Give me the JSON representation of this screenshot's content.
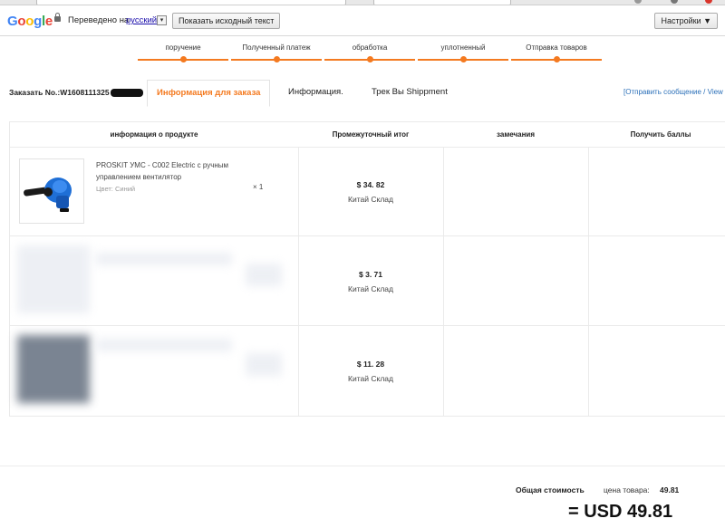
{
  "translate_bar": {
    "logo_letters": [
      {
        "ch": "G",
        "color": "#4285f4"
      },
      {
        "ch": "o",
        "color": "#ea4335"
      },
      {
        "ch": "o",
        "color": "#fbbc05"
      },
      {
        "ch": "g",
        "color": "#4285f4"
      },
      {
        "ch": "l",
        "color": "#34a853"
      },
      {
        "ch": "e",
        "color": "#ea4335"
      }
    ],
    "translated_to": "Переведено на",
    "language": "русский",
    "select_arrow": "▾",
    "show_original": "Показать исходный текст",
    "settings": "Настройки ▼"
  },
  "steps": [
    {
      "label": "поручение"
    },
    {
      "label": "Полученный платеж"
    },
    {
      "label": "обработка"
    },
    {
      "label": "уплотненный"
    },
    {
      "label": "Отправка товаров"
    }
  ],
  "order": {
    "number_prefix": "Заказать No.:W1608111325"
  },
  "tabs": {
    "active": "Информация для заказа",
    "info": "Информация.",
    "track": "Трек Вы Shippment"
  },
  "send_message": "[Отправить сообщение / View",
  "table": {
    "headers": {
      "product": "информация о продукте",
      "subtotal": "Промежуточный итог",
      "remarks": "замечания",
      "points": "Получить баллы"
    },
    "rows": [
      {
        "name": "PROSKIT УМС - С002 Electric с ручным управлением вентилятор",
        "color": "Цвет: Синий",
        "qty": "×  1",
        "price": "$ 34. 82",
        "warehouse": "Китай Склад"
      },
      {
        "price": "$ 3. 71",
        "warehouse": "Китай Склад"
      },
      {
        "price": "$ 11. 28",
        "warehouse": "Китай Склад"
      }
    ]
  },
  "totals": {
    "label": "Общая стоимость",
    "price_label": "цена товара:",
    "price_value": "49.81",
    "grand_total": "= USD 49.81"
  },
  "colors": {
    "accent": "#f47a20",
    "link": "#2a6fb8"
  }
}
